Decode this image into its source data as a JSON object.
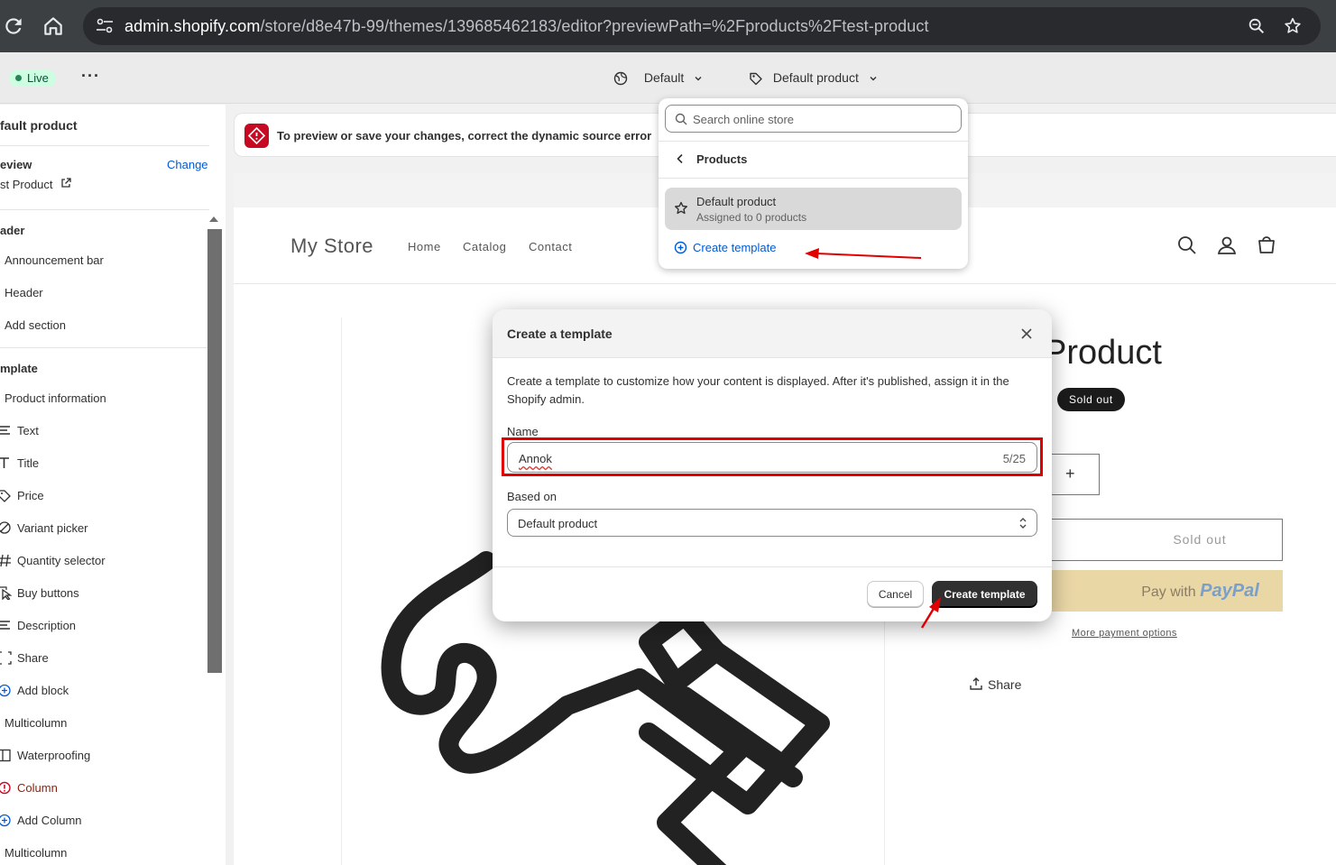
{
  "browser": {
    "url_host": "admin.shopify.com",
    "url_path": "/store/d8e47b-99/themes/139685462183/editor?previewPath=%2Fproducts%2Ftest-product"
  },
  "topbar": {
    "live_label": "Live",
    "locale_select": "Default",
    "template_select": "Default product"
  },
  "sidebar": {
    "title": "fault product",
    "preview_label": "eview",
    "preview_change": "Change",
    "preview_value": "st Product",
    "header_group": "ader",
    "header_items": [
      "Announcement bar",
      "Header"
    ],
    "add_section": "Add section",
    "template_group": "mplate",
    "product_info": "Product information",
    "blocks": [
      "Text",
      "Title",
      "Price",
      "Variant picker",
      "Quantity selector",
      "Buy buttons",
      "Description",
      "Share"
    ],
    "add_block": "Add block",
    "multicolumn": "Multicolumn",
    "waterproofing": "Waterproofing",
    "column": "Column",
    "add_column": "Add Column",
    "multicolumn2": "Multicolumn"
  },
  "banner": {
    "error_text": "To preview or save your changes, correct the dynamic source error"
  },
  "store": {
    "name": "My Store",
    "nav": [
      "Home",
      "Catalog",
      "Contact"
    ],
    "product_title": "Product",
    "sold_out_badge": "Sold out",
    "qty_plus": "+",
    "sold_out_button": "Sold out",
    "paypal_pay_with": "Pay with",
    "paypal_brand": "PayPal",
    "more_payment": "More payment options",
    "share": "Share"
  },
  "popover": {
    "search_placeholder": "Search online store",
    "back_label": "Products",
    "item_title": "Default product",
    "item_subtitle": "Assigned to 0 products",
    "create_link": "Create template"
  },
  "modal": {
    "title": "Create a template",
    "description": "Create a template to customize how your content is displayed. After it's published, assign it in the Shopify admin.",
    "name_label": "Name",
    "name_value": "Annok",
    "name_count": "5/25",
    "based_on_label": "Based on",
    "based_on_value": "Default product",
    "cancel": "Cancel",
    "create": "Create template"
  },
  "colors": {
    "accent_link": "#005bd3",
    "error": "#c70a24",
    "annotation": "#e00000",
    "primary_button": "#303030"
  }
}
